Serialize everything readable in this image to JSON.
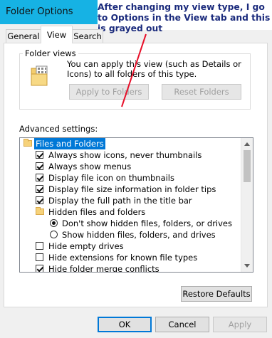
{
  "window": {
    "title": "Folder Options"
  },
  "annotation": {
    "text": "After changing my view type, I go to Options in the View tab and this is grayed out"
  },
  "tabs": [
    {
      "label": "General"
    },
    {
      "label": "View"
    },
    {
      "label": "Search"
    }
  ],
  "folder_views": {
    "group_label": "Folder views",
    "description": "You can apply this view (such as Details or Icons) to all folders of this type.",
    "apply_button": "Apply to Folders",
    "reset_button": "Reset Folders"
  },
  "advanced": {
    "label": "Advanced settings:",
    "items": [
      {
        "label": "Files and Folders",
        "type": "folder",
        "selected": true
      },
      {
        "label": "Always show icons, never thumbnails",
        "type": "checkbox",
        "checked": true
      },
      {
        "label": "Always show menus",
        "type": "checkbox",
        "checked": true
      },
      {
        "label": "Display file icon on thumbnails",
        "type": "checkbox",
        "checked": true
      },
      {
        "label": "Display file size information in folder tips",
        "type": "checkbox",
        "checked": true
      },
      {
        "label": "Display the full path in the title bar",
        "type": "checkbox",
        "checked": true
      },
      {
        "label": "Hidden files and folders",
        "type": "folder"
      },
      {
        "label": "Don't show hidden files, folders, or drives",
        "type": "radio",
        "checked": true
      },
      {
        "label": "Show hidden files, folders, and drives",
        "type": "radio",
        "checked": false
      },
      {
        "label": "Hide empty drives",
        "type": "checkbox",
        "checked": false
      },
      {
        "label": "Hide extensions for known file types",
        "type": "checkbox",
        "checked": false
      },
      {
        "label": "Hide folder merge conflicts",
        "type": "checkbox",
        "checked": true
      }
    ],
    "restore_button": "Restore Defaults"
  },
  "footer": {
    "ok": "OK",
    "cancel": "Cancel",
    "apply": "Apply"
  },
  "colors": {
    "titlebar": "#16b2e4",
    "annotation_text": "#1a2a7c",
    "highlight": "#0078d7",
    "annotation_line": "#e8102a"
  }
}
